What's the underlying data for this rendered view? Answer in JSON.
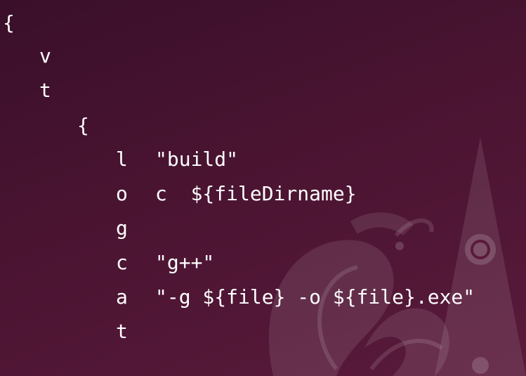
{
  "terminal": {
    "lines": [
      {
        "text": "{"
      },
      {
        "text": "v"
      },
      {
        "text": "t"
      },
      {
        "text": "{"
      }
    ],
    "entries": [
      {
        "key": "l",
        "value": "\"build\""
      },
      {
        "key": "o",
        "value": "c  ${fileDirname}"
      },
      {
        "key": "g",
        "value": ""
      },
      {
        "key": "c",
        "value": "\"g++\""
      },
      {
        "key": "a",
        "value": "\"-g ${file} -o ${file}.exe\""
      },
      {
        "key": "t",
        "value": ""
      }
    ]
  },
  "theme": {
    "background": "#4a1431",
    "text": "#ffffff",
    "wallpaper_graphic": "#7a3a5c"
  }
}
